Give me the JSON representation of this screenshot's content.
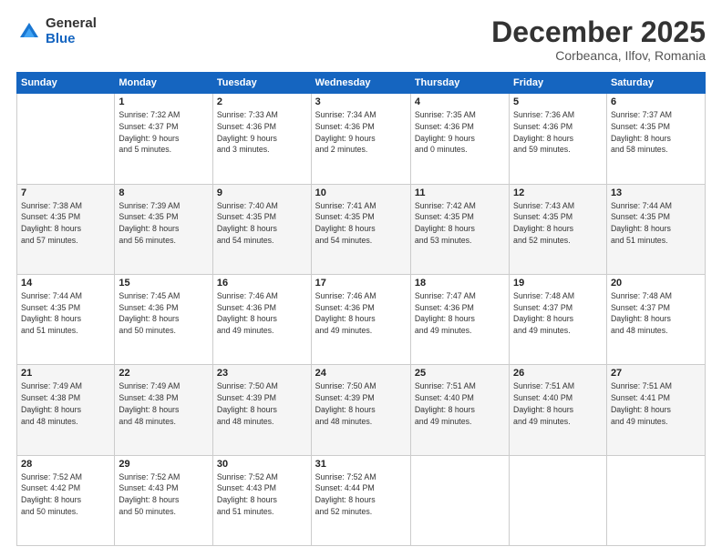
{
  "logo": {
    "general": "General",
    "blue": "Blue"
  },
  "title": "December 2025",
  "subtitle": "Corbeanca, Ilfov, Romania",
  "days_header": [
    "Sunday",
    "Monday",
    "Tuesday",
    "Wednesday",
    "Thursday",
    "Friday",
    "Saturday"
  ],
  "weeks": [
    [
      {
        "day": "",
        "info": ""
      },
      {
        "day": "1",
        "info": "Sunrise: 7:32 AM\nSunset: 4:37 PM\nDaylight: 9 hours\nand 5 minutes."
      },
      {
        "day": "2",
        "info": "Sunrise: 7:33 AM\nSunset: 4:36 PM\nDaylight: 9 hours\nand 3 minutes."
      },
      {
        "day": "3",
        "info": "Sunrise: 7:34 AM\nSunset: 4:36 PM\nDaylight: 9 hours\nand 2 minutes."
      },
      {
        "day": "4",
        "info": "Sunrise: 7:35 AM\nSunset: 4:36 PM\nDaylight: 9 hours\nand 0 minutes."
      },
      {
        "day": "5",
        "info": "Sunrise: 7:36 AM\nSunset: 4:36 PM\nDaylight: 8 hours\nand 59 minutes."
      },
      {
        "day": "6",
        "info": "Sunrise: 7:37 AM\nSunset: 4:35 PM\nDaylight: 8 hours\nand 58 minutes."
      }
    ],
    [
      {
        "day": "7",
        "info": "Sunrise: 7:38 AM\nSunset: 4:35 PM\nDaylight: 8 hours\nand 57 minutes."
      },
      {
        "day": "8",
        "info": "Sunrise: 7:39 AM\nSunset: 4:35 PM\nDaylight: 8 hours\nand 56 minutes."
      },
      {
        "day": "9",
        "info": "Sunrise: 7:40 AM\nSunset: 4:35 PM\nDaylight: 8 hours\nand 54 minutes."
      },
      {
        "day": "10",
        "info": "Sunrise: 7:41 AM\nSunset: 4:35 PM\nDaylight: 8 hours\nand 54 minutes."
      },
      {
        "day": "11",
        "info": "Sunrise: 7:42 AM\nSunset: 4:35 PM\nDaylight: 8 hours\nand 53 minutes."
      },
      {
        "day": "12",
        "info": "Sunrise: 7:43 AM\nSunset: 4:35 PM\nDaylight: 8 hours\nand 52 minutes."
      },
      {
        "day": "13",
        "info": "Sunrise: 7:44 AM\nSunset: 4:35 PM\nDaylight: 8 hours\nand 51 minutes."
      }
    ],
    [
      {
        "day": "14",
        "info": "Sunrise: 7:44 AM\nSunset: 4:35 PM\nDaylight: 8 hours\nand 51 minutes."
      },
      {
        "day": "15",
        "info": "Sunrise: 7:45 AM\nSunset: 4:36 PM\nDaylight: 8 hours\nand 50 minutes."
      },
      {
        "day": "16",
        "info": "Sunrise: 7:46 AM\nSunset: 4:36 PM\nDaylight: 8 hours\nand 49 minutes."
      },
      {
        "day": "17",
        "info": "Sunrise: 7:46 AM\nSunset: 4:36 PM\nDaylight: 8 hours\nand 49 minutes."
      },
      {
        "day": "18",
        "info": "Sunrise: 7:47 AM\nSunset: 4:36 PM\nDaylight: 8 hours\nand 49 minutes."
      },
      {
        "day": "19",
        "info": "Sunrise: 7:48 AM\nSunset: 4:37 PM\nDaylight: 8 hours\nand 49 minutes."
      },
      {
        "day": "20",
        "info": "Sunrise: 7:48 AM\nSunset: 4:37 PM\nDaylight: 8 hours\nand 48 minutes."
      }
    ],
    [
      {
        "day": "21",
        "info": "Sunrise: 7:49 AM\nSunset: 4:38 PM\nDaylight: 8 hours\nand 48 minutes."
      },
      {
        "day": "22",
        "info": "Sunrise: 7:49 AM\nSunset: 4:38 PM\nDaylight: 8 hours\nand 48 minutes."
      },
      {
        "day": "23",
        "info": "Sunrise: 7:50 AM\nSunset: 4:39 PM\nDaylight: 8 hours\nand 48 minutes."
      },
      {
        "day": "24",
        "info": "Sunrise: 7:50 AM\nSunset: 4:39 PM\nDaylight: 8 hours\nand 48 minutes."
      },
      {
        "day": "25",
        "info": "Sunrise: 7:51 AM\nSunset: 4:40 PM\nDaylight: 8 hours\nand 49 minutes."
      },
      {
        "day": "26",
        "info": "Sunrise: 7:51 AM\nSunset: 4:40 PM\nDaylight: 8 hours\nand 49 minutes."
      },
      {
        "day": "27",
        "info": "Sunrise: 7:51 AM\nSunset: 4:41 PM\nDaylight: 8 hours\nand 49 minutes."
      }
    ],
    [
      {
        "day": "28",
        "info": "Sunrise: 7:52 AM\nSunset: 4:42 PM\nDaylight: 8 hours\nand 50 minutes."
      },
      {
        "day": "29",
        "info": "Sunrise: 7:52 AM\nSunset: 4:43 PM\nDaylight: 8 hours\nand 50 minutes."
      },
      {
        "day": "30",
        "info": "Sunrise: 7:52 AM\nSunset: 4:43 PM\nDaylight: 8 hours\nand 51 minutes."
      },
      {
        "day": "31",
        "info": "Sunrise: 7:52 AM\nSunset: 4:44 PM\nDaylight: 8 hours\nand 52 minutes."
      },
      {
        "day": "",
        "info": ""
      },
      {
        "day": "",
        "info": ""
      },
      {
        "day": "",
        "info": ""
      }
    ]
  ]
}
